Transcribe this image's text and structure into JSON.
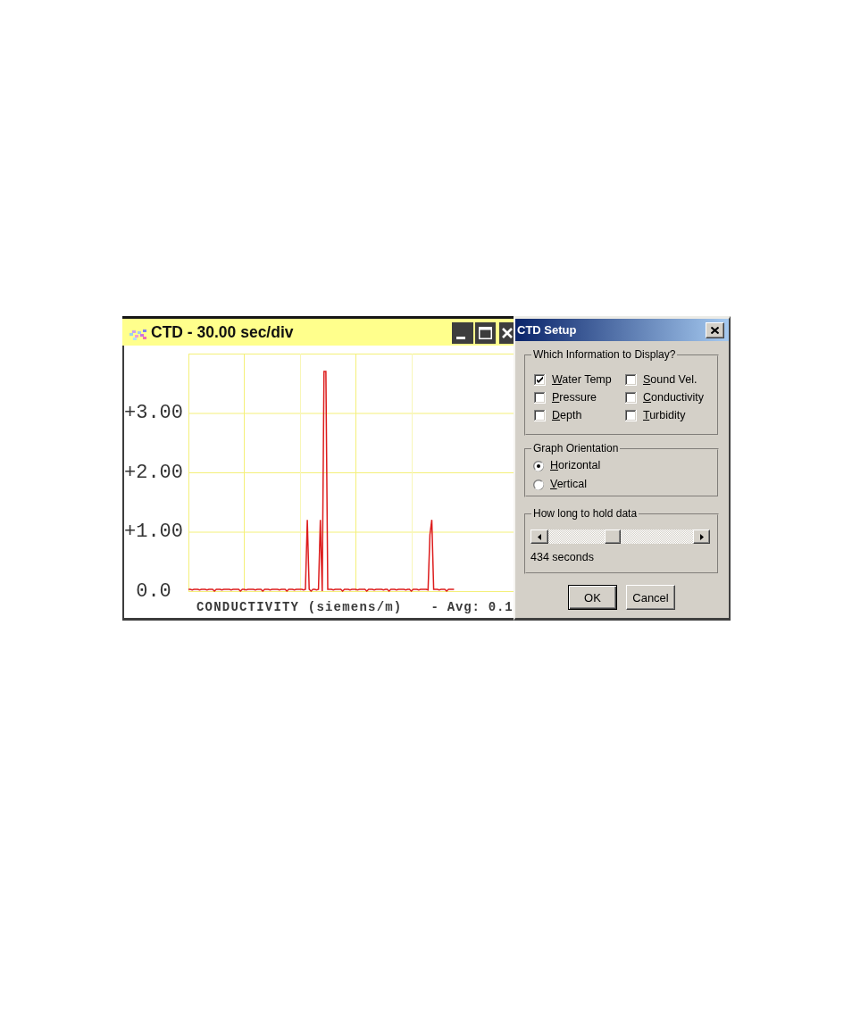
{
  "graph_window": {
    "title": "CTD - 30.00 sec/div",
    "chart": {
      "chart_data": {
        "type": "line",
        "categories": [
          null,
          null,
          null,
          null,
          null,
          null,
          null,
          null,
          null,
          null,
          null,
          null,
          null,
          null,
          null,
          null,
          null,
          null,
          null,
          null,
          null,
          null,
          null,
          null,
          null,
          null,
          null,
          null,
          null,
          null,
          null,
          null,
          null,
          null,
          null,
          null,
          null,
          null,
          null,
          null,
          null,
          null,
          null,
          null,
          null,
          null,
          null,
          null,
          null,
          null,
          null,
          null,
          null,
          null,
          null,
          null,
          null,
          null,
          null,
          null,
          null,
          null,
          null,
          null,
          null,
          null,
          null,
          null,
          null,
          null,
          null,
          null,
          null,
          null,
          null,
          null,
          null,
          null,
          null,
          null,
          null,
          null,
          null,
          null,
          null,
          null,
          null,
          null,
          null,
          null,
          null,
          null,
          null,
          null,
          null,
          null,
          null,
          null,
          null,
          null,
          null,
          null,
          null,
          null,
          null,
          null,
          null,
          null,
          null,
          null,
          null,
          null,
          null,
          null,
          null,
          null,
          null,
          null,
          null,
          null,
          null,
          null,
          null,
          null,
          null,
          null,
          null,
          null,
          null,
          null,
          null,
          null,
          null,
          null,
          null,
          null,
          null,
          null,
          null,
          null,
          null,
          null,
          null,
          null,
          null,
          null,
          null,
          null,
          null,
          null,
          null,
          null,
          null,
          null,
          null,
          null,
          null,
          null,
          null,
          null,
          null,
          null,
          null,
          null,
          null,
          null,
          null,
          null,
          null,
          null,
          null,
          null,
          null,
          null,
          null,
          null
        ],
        "series": [
          {
            "values": [
              0.03,
              0.03,
              0.02,
              0.03,
              0.03,
              0.03,
              0.02,
              0.03,
              0.03,
              0.03,
              0.02,
              0.03,
              0.03,
              0.03,
              0.0,
              0.03,
              0.03,
              0.03,
              0.02,
              0.03,
              0.03,
              0.03,
              0.03,
              0.02,
              0.03,
              0.03,
              0.03,
              0.03,
              0.0,
              0.03,
              0.03,
              0.02,
              0.03,
              0.03,
              0.03,
              0.03,
              0.02,
              0.03,
              0.03,
              0.03,
              0.0,
              0.03,
              0.03,
              0.03,
              0.02,
              0.03,
              0.03,
              0.03,
              0.03,
              0.02,
              0.03,
              0.03,
              0.03,
              0.0,
              0.03,
              0.03,
              0.03,
              0.02,
              0.03,
              0.03,
              0.03,
              0.03,
              0.02,
              0.03,
              1.2,
              0.03,
              0.0,
              0.03,
              0.03,
              0.02,
              0.03,
              1.2,
              0.0,
              3.7,
              3.7,
              0.03,
              0.03,
              0.03,
              0.02,
              0.03,
              0.03,
              0.03,
              0.03,
              0.0,
              0.03,
              0.03,
              0.03,
              0.02,
              0.03,
              0.03,
              0.03,
              0.02,
              0.03,
              0.03,
              0.03,
              0.03,
              0.0,
              0.03,
              0.03,
              0.03,
              0.02,
              0.03,
              0.03,
              0.03,
              0.03,
              0.02,
              0.03,
              0.03,
              0.0,
              0.03,
              0.03,
              0.03,
              0.02,
              0.03,
              0.03,
              0.03,
              0.03,
              0.02,
              0.03,
              0.03,
              0.0,
              0.03,
              0.03,
              0.03,
              0.02,
              0.03,
              0.03,
              0.03,
              0.03,
              0.02,
              0.95,
              1.2,
              0.03,
              0.03,
              0.03,
              0.02,
              0.03,
              0.03,
              0.03,
              0.0,
              0.03,
              0.03,
              0.03,
              0.03,
              null,
              null,
              null,
              null,
              null,
              null,
              null,
              null,
              null,
              null,
              null,
              null,
              null,
              null,
              null,
              null,
              null,
              null,
              null,
              null,
              null,
              null,
              null,
              null,
              null,
              null,
              null,
              null,
              null,
              null,
              null,
              null
            ]
          }
        ],
        "ylim": [
          0,
          4
        ],
        "yticks": [
          {
            "value": 0,
            "label": "0.0"
          },
          {
            "value": 1,
            "label": "+1.00"
          },
          {
            "value": 2,
            "label": "+2.00"
          },
          {
            "value": 3,
            "label": "+3.00"
          }
        ],
        "grid": true
      },
      "caption": "CONDUCTIVITY (siemens/m)",
      "average": "- Avg: 0.1"
    }
  },
  "dialog": {
    "title": "CTD Setup",
    "display_group": {
      "label": "Which Information to Display?",
      "options": [
        {
          "label": "Water Temp",
          "checked": true
        },
        {
          "label": "Sound Vel.",
          "checked": false
        },
        {
          "label": "Pressure",
          "checked": false
        },
        {
          "label": "Conductivity",
          "checked": false
        },
        {
          "label": "Depth",
          "checked": false
        },
        {
          "label": "Turbidity",
          "checked": false
        }
      ]
    },
    "orientation_group": {
      "label": "Graph Orientation",
      "options": [
        {
          "label": "Horizontal",
          "selected": true
        },
        {
          "label": "Vertical",
          "selected": false
        }
      ]
    },
    "hold_group": {
      "label": "How long to hold data",
      "slider": {
        "level": 0.44
      },
      "reading": "434 seconds"
    },
    "buttons": [
      {
        "label": "OK",
        "default": true
      },
      {
        "label": "Cancel",
        "default": false
      }
    ]
  }
}
